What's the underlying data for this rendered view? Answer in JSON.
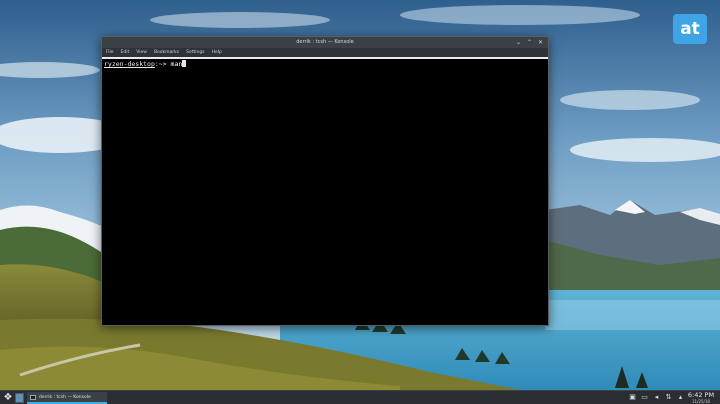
{
  "window": {
    "title": "derrik : tcsh — Konsole",
    "controls": [
      "⌄",
      "⌃",
      "✕"
    ]
  },
  "menubar": {
    "items": [
      "File",
      "Edit",
      "View",
      "Bookmarks",
      "Settings",
      "Help"
    ]
  },
  "terminal": {
    "prompt_host": "ryzen-desktop",
    "prompt_path": ":~> ",
    "command": "man"
  },
  "taskbar": {
    "task_label": "derrik : tcsh — Konsole",
    "clock_time": "6:42 PM",
    "clock_date": "11/25/18"
  },
  "watermark": {
    "logo_text": "at"
  },
  "colors": {
    "accent": "#3daee9",
    "titlebar": "#3b4045",
    "taskbar": "#2a2e32",
    "terminal_bg": "#000000"
  }
}
